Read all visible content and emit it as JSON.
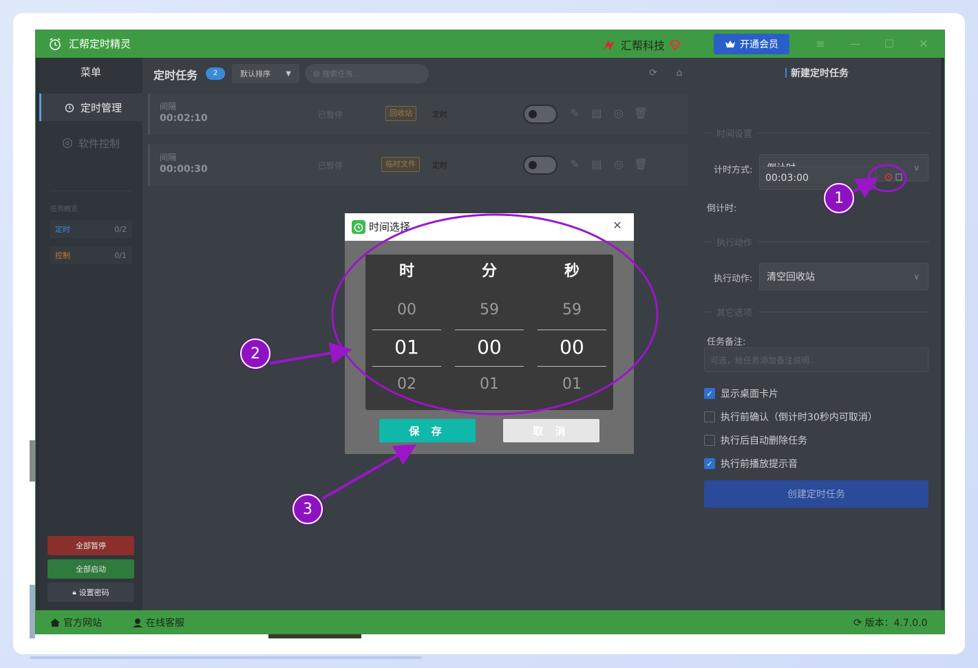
{
  "titlebar": {
    "app_title": "汇帮定时精灵",
    "brand": "汇帮科技",
    "vip_button": "开通会员"
  },
  "sidebar": {
    "menu_title": "菜单",
    "items": [
      {
        "label": "定时管理",
        "icon": "alarm-clock-icon",
        "active": true
      },
      {
        "label": "软件控制",
        "icon": "hexagon-gear-icon",
        "active": false
      }
    ],
    "overview_title": "任务概览",
    "stats": [
      {
        "label": "定时",
        "value": "0/2",
        "color": "#3a8ad8"
      },
      {
        "label": "控制",
        "value": "0/1",
        "color": "#c97a2a"
      }
    ],
    "buttons": {
      "pause_all": "全部暂停",
      "start_all": "全部启动",
      "set_password": "设置密码"
    }
  },
  "tasks": {
    "title": "定时任务",
    "count": "2",
    "sort_label": "默认排序",
    "search_placeholder": "搜索任务...",
    "rows": [
      {
        "type": "间隔",
        "interval": "00:02:10",
        "status": "已暂停",
        "tag": "回收站",
        "kind": "定时"
      },
      {
        "type": "间隔",
        "interval": "00:00:30",
        "status": "已暂停",
        "tag": "临时文件",
        "kind": "定时"
      }
    ]
  },
  "new_task": {
    "title": "新建定时任务",
    "time_section": "时间设置",
    "mode_label": "计时方式:",
    "mode_value": "倒计时",
    "countdown_label": "倒计时:",
    "countdown_value": "00:03:00",
    "action_section": "执行动作",
    "action_label": "执行动作:",
    "action_value": "清空回收站",
    "other_section": "其它选项",
    "note_label": "任务备注:",
    "note_placeholder": "可选，给任务添加备注说明...",
    "options": [
      {
        "label": "显示桌面卡片",
        "checked": true
      },
      {
        "label": "执行前确认（倒计时30秒内可取消）",
        "checked": false
      },
      {
        "label": "执行后自动删除任务",
        "checked": false
      },
      {
        "label": "执行前播放提示音",
        "checked": true
      }
    ],
    "create_button": "创建定时任务"
  },
  "footer": {
    "website": "官方网站",
    "support": "在线客服",
    "version": "版本：4.7.0.0"
  },
  "dialog": {
    "title": "时间选择",
    "columns": [
      {
        "head": "时",
        "prev": "00",
        "selected": "01",
        "next": "02"
      },
      {
        "head": "分",
        "prev": "59",
        "selected": "00",
        "next": "01"
      },
      {
        "head": "秒",
        "prev": "59",
        "selected": "00",
        "next": "01"
      }
    ],
    "save": "保 存",
    "cancel": "取 消"
  },
  "annotations": {
    "color": "#9a16c9",
    "steps": [
      "1",
      "2",
      "3"
    ]
  }
}
